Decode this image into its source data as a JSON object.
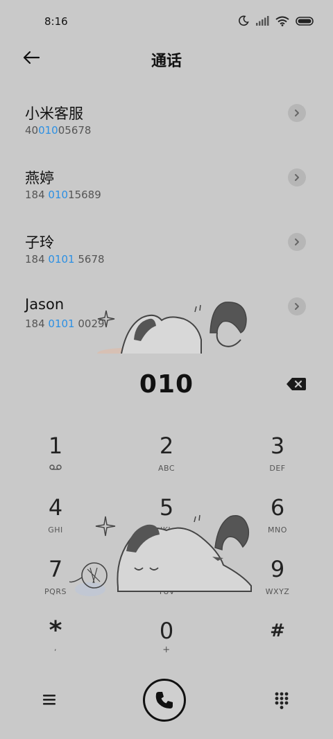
{
  "status": {
    "time": "8:16",
    "icons": [
      "moon-icon",
      "signal-icon",
      "wifi-icon",
      "battery-icon"
    ]
  },
  "header": {
    "title": "通话",
    "back_icon": "arrow-left-icon"
  },
  "contacts": [
    {
      "name": "小米客服",
      "number_pre": "40",
      "number_hl": "010",
      "number_post": "05678"
    },
    {
      "name": "燕婷",
      "number_pre": "184 ",
      "number_hl": "010",
      "number_post": "15689"
    },
    {
      "name": "子玲",
      "number_pre": "184 ",
      "number_hl": "0101",
      "number_post": " 5678"
    },
    {
      "name": "Jason",
      "number_pre": "184 ",
      "number_hl": "0101",
      "number_post": " 0029"
    }
  ],
  "dial": {
    "number": "010"
  },
  "keypad": [
    {
      "digit": "1",
      "letters": ""
    },
    {
      "digit": "2",
      "letters": "ABC"
    },
    {
      "digit": "3",
      "letters": "DEF"
    },
    {
      "digit": "4",
      "letters": "GHI"
    },
    {
      "digit": "5",
      "letters": "JKL"
    },
    {
      "digit": "6",
      "letters": "MNO"
    },
    {
      "digit": "7",
      "letters": "PQRS"
    },
    {
      "digit": "8",
      "letters": "TUV"
    },
    {
      "digit": "9",
      "letters": "WXYZ"
    },
    {
      "digit": "*",
      "letters": ","
    },
    {
      "digit": "0",
      "letters": "+"
    },
    {
      "digit": "#",
      "letters": ""
    }
  ],
  "colors": {
    "background": "#c9c9c9",
    "highlight": "#2b8fe3",
    "text": "#111111"
  },
  "bottom": {
    "menu_icon": "menu-icon",
    "call_icon": "phone-icon",
    "keypad_icon": "dialpad-icon"
  }
}
